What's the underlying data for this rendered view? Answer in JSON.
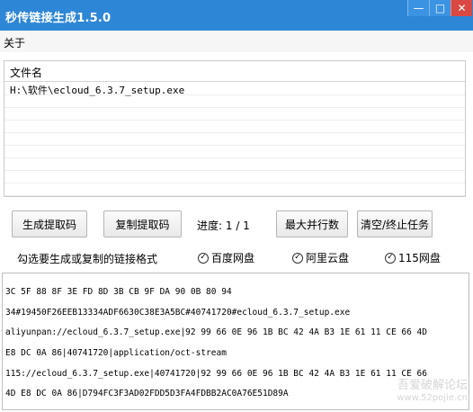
{
  "window": {
    "title": "秒传链接生成1.5.0"
  },
  "menu": {
    "about": "关于"
  },
  "file_list": {
    "header": "文件名",
    "rows": [
      "H:\\软件\\ecloud_6.3.7_setup.exe"
    ]
  },
  "buttons": {
    "generate": "生成提取码",
    "copy": "复制提取码",
    "max_parallel": "最大并行数",
    "clear_stop": "清空/终止任务"
  },
  "progress": {
    "label": "进度:",
    "value": "1 / 1"
  },
  "format": {
    "label": "勾选要生成或复制的链接格式",
    "options": [
      "百度网盘",
      "阿里云盘",
      "115网盘"
    ]
  },
  "output": {
    "lines": [
      "3C 5F 88 8F 3E FD 8D 3B CB 9F DA 90 0B 80 94",
      "34#19450F26EEB13334ADF6630C38E3A5BC#40741720#ecloud_6.3.7_setup.exe",
      "aliyunpan://ecloud_6.3.7_setup.exe|92 99 66 0E 96 1B BC 42 4A B3 1E 61 11 CE 66 4D",
      "E8 DC 0A 86|40741720|application/oct-stream",
      "115://ecloud_6.3.7_setup.exe|40741720|92 99 66 0E 96 1B BC 42 4A B3 1E 61 11 CE 66",
      "4D E8 DC 0A 86|D794FC3F3AD02FDD5D3FA4FDBB2AC0A76E51D89A"
    ]
  },
  "watermark": {
    "line1": "吾爱破解论坛",
    "line2": "www.52pojie.cn"
  }
}
